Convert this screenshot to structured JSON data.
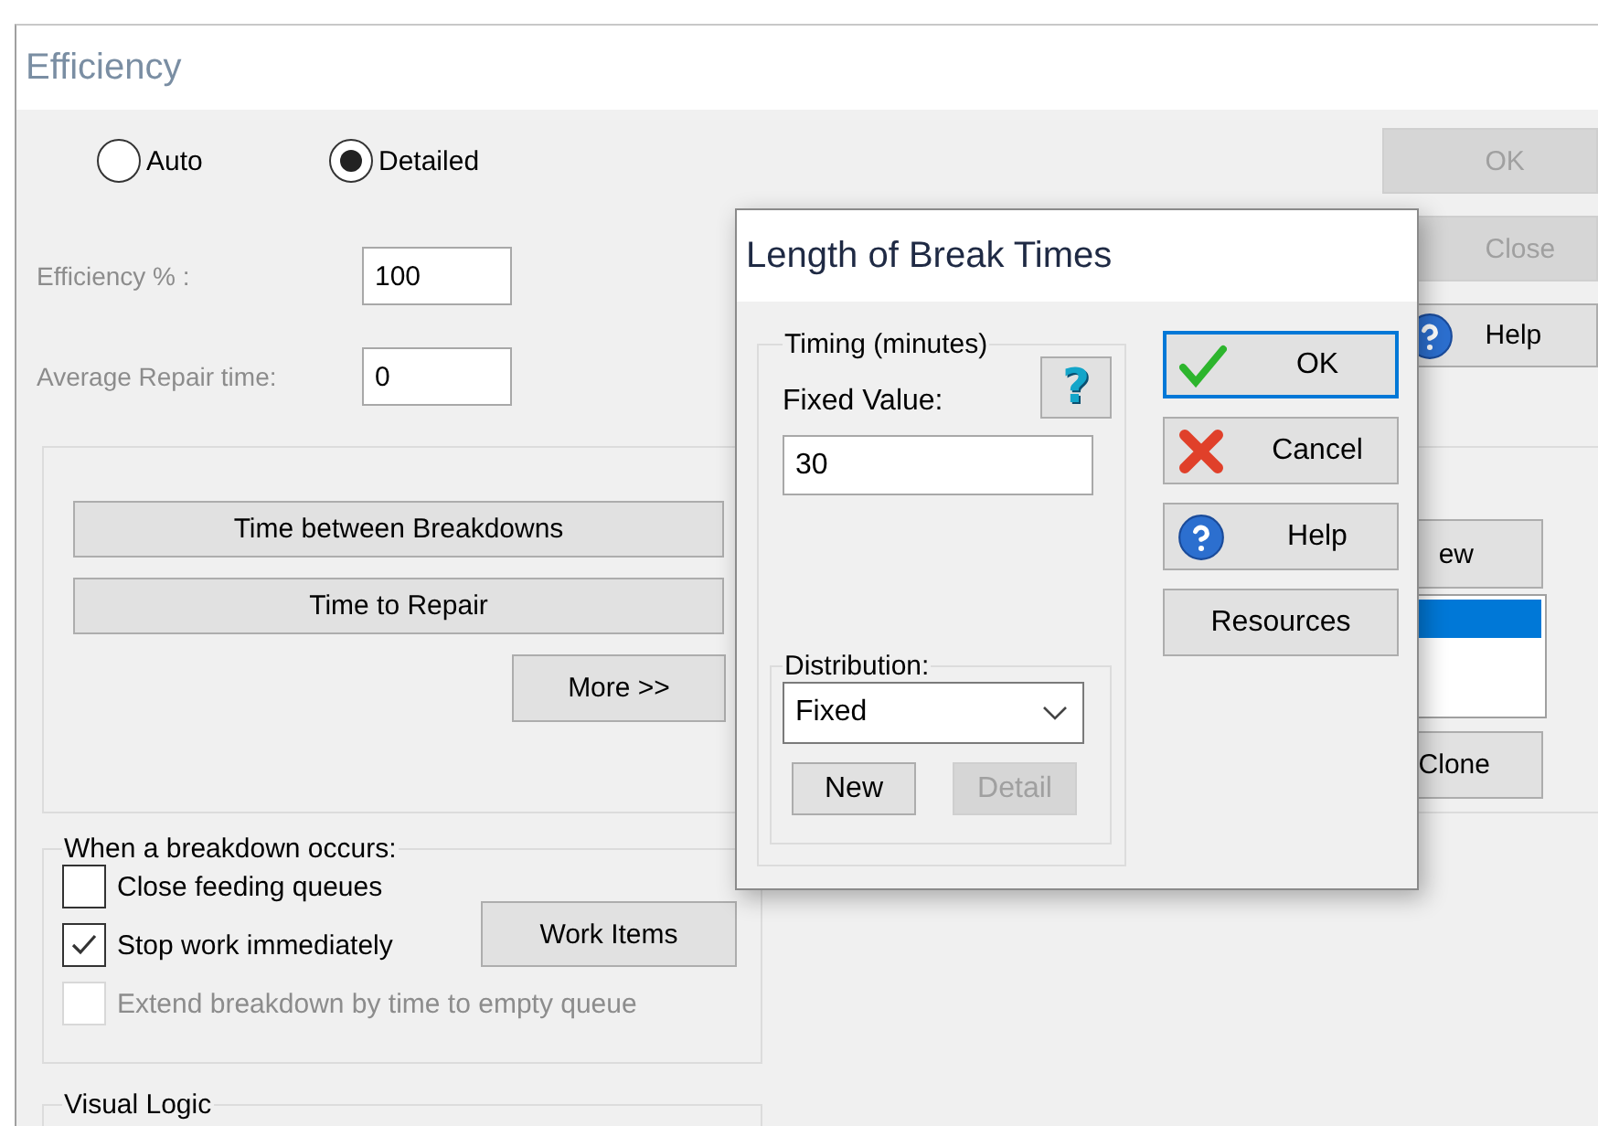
{
  "window": {
    "title": "Efficiency"
  },
  "mode": [
    {
      "label": "Auto",
      "selected": false
    },
    {
      "label": "Detailed",
      "selected": true
    }
  ],
  "fields": [
    {
      "label": "Efficiency % :",
      "value": "100",
      "disabled": true
    },
    {
      "label": "Average Repair time:",
      "value": "0",
      "disabled": true
    }
  ],
  "side_buttons": [
    {
      "label": "OK",
      "disabled": true,
      "kind": "plain"
    },
    {
      "label": "Close",
      "disabled": true,
      "kind": "plain"
    },
    {
      "label": "Help",
      "disabled": false,
      "kind": "help"
    }
  ],
  "timing_buttons": [
    {
      "label": "Time between Breakdowns"
    },
    {
      "label": "Time to Repair"
    }
  ],
  "more_button": "More >>",
  "resource_list": {
    "new_button": "ew",
    "rows": [
      {
        "selected": true
      }
    ],
    "clone_button": "Clone"
  },
  "breakdown": {
    "title": "When a breakdown occurs:",
    "options": [
      {
        "label": "Close feeding queues",
        "checked": false,
        "disabled": false
      },
      {
        "label": "Stop work immediately",
        "checked": true,
        "disabled": false
      },
      {
        "label": "Extend breakdown by time to empty queue",
        "checked": false,
        "disabled": true
      }
    ],
    "work_items_button": "Work Items"
  },
  "visual_logic": {
    "title": "Visual Logic"
  },
  "dialog": {
    "title": "Length of Break Times",
    "timing": {
      "title": "Timing (minutes)",
      "help_glyph": "?",
      "fixed_label": "Fixed Value:",
      "fixed_value": "30"
    },
    "distribution": {
      "title": "Distribution:",
      "value": "Fixed",
      "buttons": [
        {
          "label": "New",
          "disabled": false
        },
        {
          "label": "Detail",
          "disabled": true
        }
      ]
    },
    "buttons": [
      {
        "label": "OK",
        "kind": "ok",
        "focused": true
      },
      {
        "label": "Cancel",
        "kind": "cancel",
        "focused": false
      },
      {
        "label": "Help",
        "kind": "help",
        "focused": false
      },
      {
        "label": "Resources",
        "kind": "plain",
        "focused": false
      }
    ]
  }
}
